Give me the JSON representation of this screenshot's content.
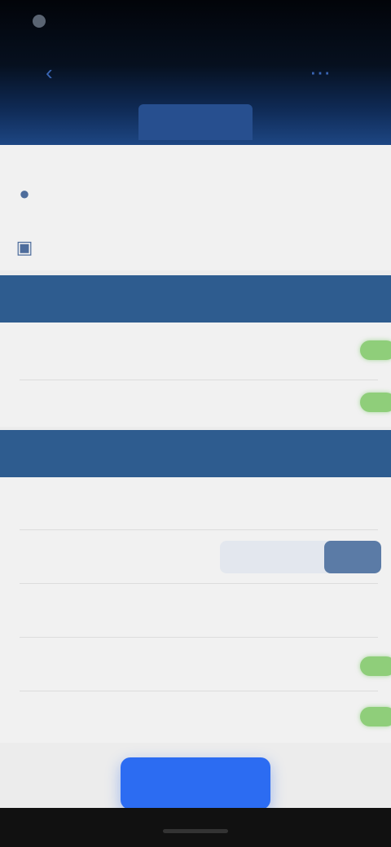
{
  "status_bar": {
    "time": ""
  },
  "nav": {
    "title": "",
    "back_icon": "back-icon",
    "action_icon": "action-icon"
  },
  "header_tab": {
    "label": ""
  },
  "top_list": [
    {
      "label": "",
      "icon": "person-icon"
    },
    {
      "label": "",
      "icon": "calendar-icon"
    }
  ],
  "sections": [
    {
      "title": "",
      "items": [
        {
          "label": "",
          "sublabel": "",
          "toggle": true
        },
        {
          "label": "",
          "toggle": true
        }
      ]
    },
    {
      "title": "",
      "items": [
        {
          "label": ""
        },
        {
          "label": "",
          "segmented": {
            "options": [
              "",
              ""
            ],
            "selected_index": 1
          }
        },
        {
          "label": ""
        },
        {
          "label": "",
          "toggle": true
        },
        {
          "label": "",
          "toggle": true
        }
      ]
    }
  ],
  "cta": {
    "label": ""
  },
  "colors": {
    "accent": "#2c6cf2",
    "section": "#2e5c8f",
    "toggle_on": "#8fce7a"
  }
}
